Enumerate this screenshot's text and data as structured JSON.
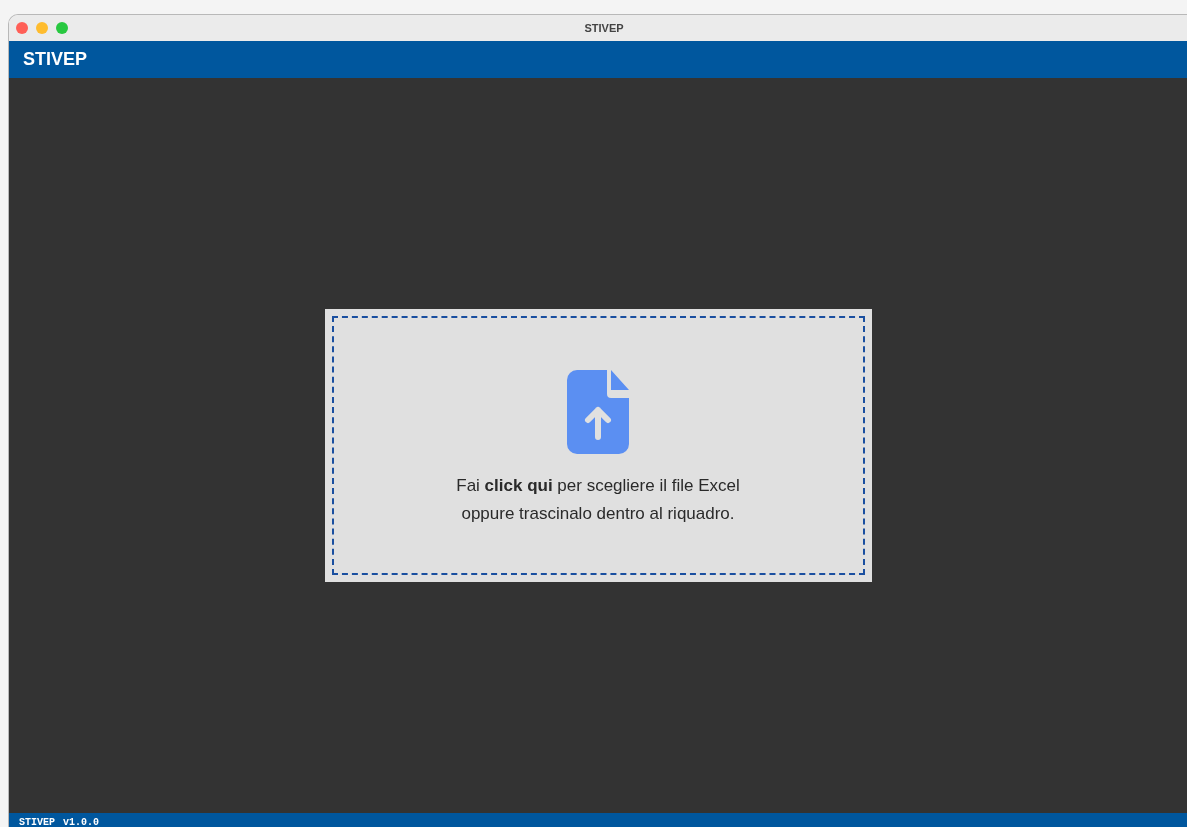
{
  "window": {
    "title": "STIVEP"
  },
  "header": {
    "title": "STIVEP"
  },
  "dropzone": {
    "text": "Fai **click qui** per scegliere il file Excel oppure trascinalo dentro al riquadro."
  },
  "status_bar": {
    "name": "STIVEP",
    "version": "v1.0.0"
  }
}
